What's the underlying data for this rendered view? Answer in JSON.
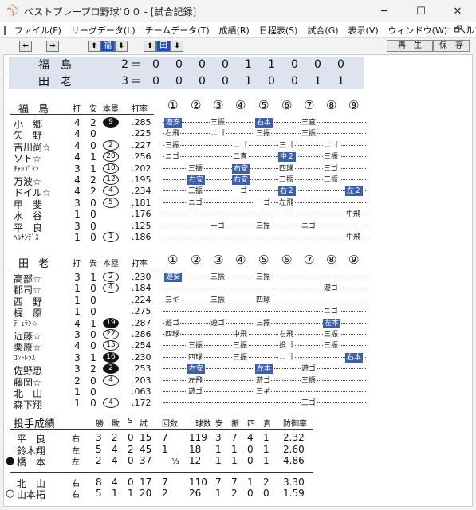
{
  "window": {
    "app_icon": "baseball-icon",
    "title": "ベストプレープロ野球'００ - [試合記録]",
    "minimize": "─",
    "maximize": "☐",
    "close": "✕"
  },
  "menu": {
    "items": [
      "ファイル(F)",
      "リーグデータ(L)",
      "チームデータ(T)",
      "成績(R)",
      "日程表(S)",
      "試合(G)",
      "表示(V)",
      "ウィンドウ(W)",
      "ヘルプ(H)"
    ],
    "mdi": [
      "－",
      "🗗",
      "×"
    ]
  },
  "toolbar": {
    "prev": "⬅",
    "next": "➡",
    "team1_up": "⬆",
    "team1": "福",
    "team1_down": "⬇",
    "team2_up": "⬆",
    "team2": "田",
    "team2_down": "⬇",
    "replay": "再　生",
    "save": "保　存"
  },
  "scoreboard": [
    {
      "team": "福島",
      "total": "2",
      "eq": "＝",
      "innings": [
        "0",
        "0",
        "0",
        "0",
        "1",
        "1",
        "0",
        "0",
        "0"
      ]
    },
    {
      "team": "田老",
      "total": "3",
      "eq": "＝",
      "innings": [
        "0",
        "0",
        "0",
        "0",
        "1",
        "0",
        "0",
        "1",
        "1"
      ]
    }
  ],
  "columns": {
    "hits_at": "打",
    "hits": "安",
    "hr": "本塁",
    "avg": "打率"
  },
  "innings_header": [
    "①",
    "②",
    "③",
    "④",
    "⑤",
    "⑥",
    "⑦",
    "⑧",
    "⑨"
  ],
  "batting": [
    {
      "team": "福島",
      "players": [
        {
          "name": "小　郷",
          "ab": "4",
          "h": "2",
          "hr": "9",
          "hr_filled": true,
          "avg": ".285",
          "res": [
            [
              "遊安",
              1,
              true
            ],
            [
              "三振",
              3,
              false
            ],
            [
              "右本",
              5,
              true
            ],
            [
              "三直",
              7,
              false
            ]
          ]
        },
        {
          "name": "矢　野",
          "ab": "4",
          "h": "0",
          "hr": "",
          "hr_filled": false,
          "avg": ".225",
          "res": [
            [
              "右飛",
              1,
              false
            ],
            [
              "ニゴ",
              3,
              false
            ],
            [
              "三振",
              5,
              false
            ],
            [
              "三振",
              7,
              false
            ]
          ]
        },
        {
          "name": "吉川尚☆",
          "ab": "4",
          "h": "0",
          "hr": "2",
          "hr_filled": false,
          "avg": ".227",
          "res": [
            [
              "三振",
              1,
              false
            ],
            [
              "ニゴ",
              4,
              false
            ],
            [
              "三ゴ",
              6,
              false
            ],
            [
              "ニゴ",
              8,
              false
            ]
          ]
        },
        {
          "name": "ソト☆",
          "ab": "4",
          "h": "1",
          "hr": "20",
          "hr_filled": false,
          "avg": ".256",
          "res": [
            [
              "ニゴ",
              1,
              false
            ],
            [
              "二直",
              4,
              false
            ],
            [
              "中２",
              6,
              true
            ],
            [
              "三振",
              8,
              false
            ]
          ]
        },
        {
          "name": "ﾁｬｯﾌﾟﾏﾝ",
          "ab": "3",
          "h": "1",
          "hr": "10",
          "hr_filled": false,
          "avg": ".202",
          "res": [
            [
              "三振",
              2,
              false
            ],
            [
              "右安",
              4,
              true
            ],
            [
              "四球",
              6,
              false
            ],
            [
              "三ゴ",
              8,
              false
            ]
          ]
        },
        {
          "name": "万波☆",
          "ab": "4",
          "h": "2",
          "hr": "12",
          "hr_filled": false,
          "avg": ".195",
          "res": [
            [
              "右安",
              2,
              true
            ],
            [
              "右安",
              4,
              true
            ],
            [
              "三振",
              6,
              false
            ],
            [
              "三振",
              8,
              false
            ]
          ]
        },
        {
          "name": "ドイル☆",
          "ab": "4",
          "h": "2",
          "hr": "4",
          "hr_filled": false,
          "avg": ".234",
          "res": [
            [
              "三振",
              2,
              false
            ],
            [
              "ーゴ",
              4,
              false
            ],
            [
              "右２",
              6,
              true
            ],
            [
              "左２",
              9,
              true
            ]
          ]
        },
        {
          "name": "甲　斐",
          "ab": "3",
          "h": "0",
          "hr": "5",
          "hr_filled": false,
          "avg": ".181",
          "res": [
            [
              "ニゴ",
              2,
              false
            ],
            [
              "ーゴ",
              5,
              false
            ],
            [
              "左飛",
              6,
              false
            ]
          ]
        },
        {
          "name": "水　谷",
          "ab": "1",
          "h": "0",
          "hr": "",
          "hr_filled": false,
          "avg": ".176",
          "res": [
            [
              "中飛",
              9,
              false
            ]
          ]
        },
        {
          "name": "平　良",
          "ab": "3",
          "h": "0",
          "hr": "",
          "hr_filled": false,
          "avg": ".125",
          "res": [
            [
              "ーゴ",
              3,
              false
            ],
            [
              "三振",
              5,
              false
            ],
            [
              "ニゴ",
              7,
              false
            ]
          ]
        },
        {
          "name": "ﾍﾙﾅﾝﾃﾞｽ",
          "ab": "1",
          "h": "0",
          "hr": "1",
          "hr_filled": false,
          "avg": ".186",
          "res": [
            [
              "中飛",
              9,
              false
            ]
          ]
        }
      ]
    },
    {
      "team": "田老",
      "players": [
        {
          "name": "高部☆",
          "ab": "3",
          "h": "1",
          "hr": "2",
          "hr_filled": false,
          "avg": ".230",
          "res": [
            [
              "遊安",
              1,
              true
            ],
            [
              "三振",
              3,
              false
            ],
            [
              "三振",
              5,
              false
            ]
          ]
        },
        {
          "name": "郡司☆",
          "ab": "1",
          "h": "0",
          "hr": "4",
          "hr_filled": false,
          "avg": ".184",
          "res": [
            [
              "遊ゴ",
              8,
              false
            ]
          ]
        },
        {
          "name": "西　野",
          "ab": "1",
          "h": "0",
          "hr": "",
          "hr_filled": false,
          "avg": ".224",
          "res": [
            [
              "三ギ",
              1,
              false
            ],
            [
              "三振",
              3,
              false
            ],
            [
              "四球",
              5,
              false
            ]
          ]
        },
        {
          "name": "梶　原",
          "ab": "1",
          "h": "0",
          "hr": "",
          "hr_filled": false,
          "avg": ".275",
          "res": [
            [
              "ニゴ",
              8,
              false
            ]
          ]
        },
        {
          "name": "ﾃﾞｭﾗﾝ☆",
          "ab": "4",
          "h": "1",
          "hr": "19",
          "hr_filled": true,
          "avg": ".287",
          "res": [
            [
              "遊ゴ",
              1,
              false
            ],
            [
              "遊ゴ",
              3,
              false
            ],
            [
              "三振",
              5,
              false
            ],
            [
              "左本",
              8,
              true
            ]
          ]
        },
        {
          "name": "近藤☆",
          "ab": "3",
          "h": "0",
          "hr": "22",
          "hr_filled": false,
          "avg": ".286",
          "res": [
            [
              "四球",
              1,
              false
            ],
            [
              "中飛",
              4,
              false
            ],
            [
              "右飛",
              6,
              false
            ],
            [
              "三振",
              8,
              false
            ]
          ]
        },
        {
          "name": "栗原☆",
          "ab": "4",
          "h": "0",
          "hr": "15",
          "hr_filled": false,
          "avg": ".254",
          "res": [
            [
              "三振",
              2,
              false
            ],
            [
              "三振",
              4,
              false
            ],
            [
              "投ゴ",
              6,
              false
            ],
            [
              "三振",
              8,
              false
            ]
          ]
        },
        {
          "name": "ｺﾝﾄﾚﾗｽ",
          "ab": "3",
          "h": "1",
          "hr": "16",
          "hr_filled": true,
          "avg": ".230",
          "res": [
            [
              "四球",
              2,
              false
            ],
            [
              "三振",
              4,
              false
            ],
            [
              "ニゴ",
              6,
              false
            ],
            [
              "右本",
              9,
              true
            ]
          ]
        },
        {
          "name": "佐野恵",
          "ab": "3",
          "h": "2",
          "hr": "2",
          "hr_filled": true,
          "avg": ".253",
          "res": [
            [
              "右安",
              2,
              true
            ],
            [
              "左本",
              5,
              true
            ],
            [
              "遊ゴ",
              7,
              false
            ]
          ]
        },
        {
          "name": "藤岡☆",
          "ab": "2",
          "h": "0",
          "hr": "4",
          "hr_filled": false,
          "avg": ".203",
          "res": [
            [
              "左飛",
              2,
              false
            ],
            [
              "遊ゴ",
              5,
              false
            ],
            [
              "三振",
              7,
              false
            ]
          ]
        },
        {
          "name": "北　山",
          "ab": "1",
          "h": "0",
          "hr": "",
          "hr_filled": false,
          "avg": ".063",
          "res": [
            [
              "遊ゴ",
              2,
              false
            ],
            [
              "三ギ",
              5,
              false
            ]
          ]
        },
        {
          "name": "森下翔",
          "ab": "1",
          "h": "0",
          "hr": "4",
          "hr_filled": false,
          "avg": ".172",
          "res": [
            [
              "三ゴ",
              7,
              false
            ]
          ]
        }
      ]
    }
  ],
  "pitching": {
    "title": "投手成績",
    "headers": [
      "勝",
      "敗",
      "S",
      "試",
      "回数",
      "球数",
      "安",
      "振",
      "四",
      "責",
      "防御率"
    ],
    "teams": [
      [
        {
          "mark": "",
          "name": "平　良",
          "hand": "右",
          "w": "3",
          "l": "2",
          "s": "0",
          "g": "15",
          "ip": "7",
          "ipf": "",
          "np": "119",
          "h": "3",
          "k": "7",
          "bb": "4",
          "er": "1",
          "era": "2.32"
        },
        {
          "mark": "",
          "name": "鈴木翔",
          "hand": "左",
          "w": "5",
          "l": "4",
          "s": "2",
          "g": "45",
          "ip": "1",
          "ipf": "",
          "np": "18",
          "h": "1",
          "k": "1",
          "bb": "0",
          "er": "1",
          "era": "2.60"
        },
        {
          "mark": "●",
          "name": "橋　本",
          "hand": "左",
          "w": "2",
          "l": "4",
          "s": "0",
          "g": "37",
          "ip": "",
          "ipf": "⅓",
          "np": "12",
          "h": "1",
          "k": "1",
          "bb": "0",
          "er": "1",
          "era": "4.86"
        }
      ],
      [
        {
          "mark": "",
          "name": "北　山",
          "hand": "右",
          "w": "8",
          "l": "4",
          "s": "0",
          "g": "17",
          "ip": "7",
          "ipf": "",
          "np": "110",
          "h": "7",
          "k": "7",
          "bb": "1",
          "er": "2",
          "era": "3.30"
        },
        {
          "mark": "○",
          "name": "山本拓",
          "hand": "右",
          "w": "5",
          "l": "1",
          "s": "1",
          "g": "20",
          "ip": "2",
          "ipf": "",
          "np": "26",
          "h": "1",
          "k": "2",
          "bb": "0",
          "er": "0",
          "era": "1.59"
        }
      ]
    ]
  }
}
